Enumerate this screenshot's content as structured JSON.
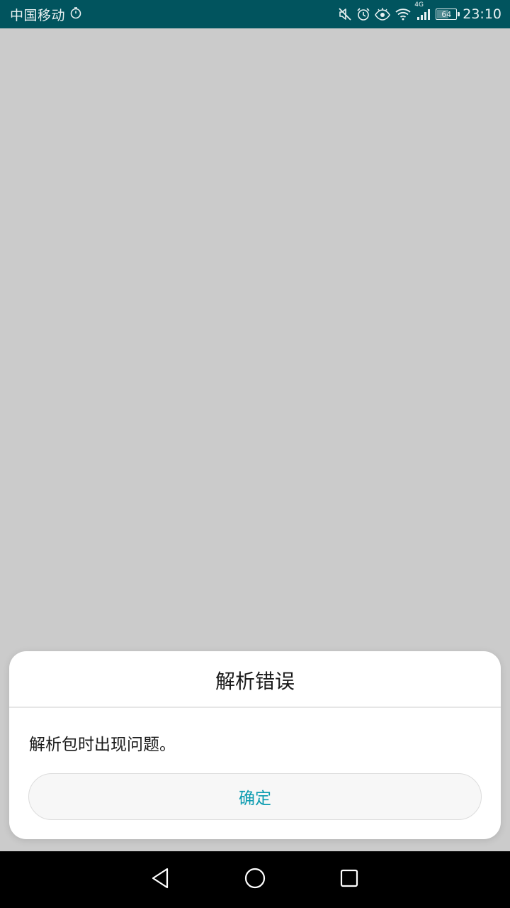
{
  "status_bar": {
    "carrier": "中国移动",
    "network_type": "4G",
    "battery_percent": "64",
    "battery_level": 0.64,
    "time": "23:10",
    "icons": [
      "stopwatch-icon",
      "mute-icon",
      "alarm-icon",
      "eye-comfort-icon",
      "wifi-icon",
      "signal-icon",
      "battery-icon"
    ]
  },
  "dialog": {
    "title": "解析错误",
    "message": "解析包时出现问题。",
    "confirm_label": "确定"
  },
  "nav_bar": {
    "icons": [
      "back-icon",
      "home-icon",
      "recents-icon"
    ]
  },
  "colors": {
    "status_bar_bg": "#01545e",
    "background": "#cbcbcb",
    "accent": "#0a9bb0"
  }
}
